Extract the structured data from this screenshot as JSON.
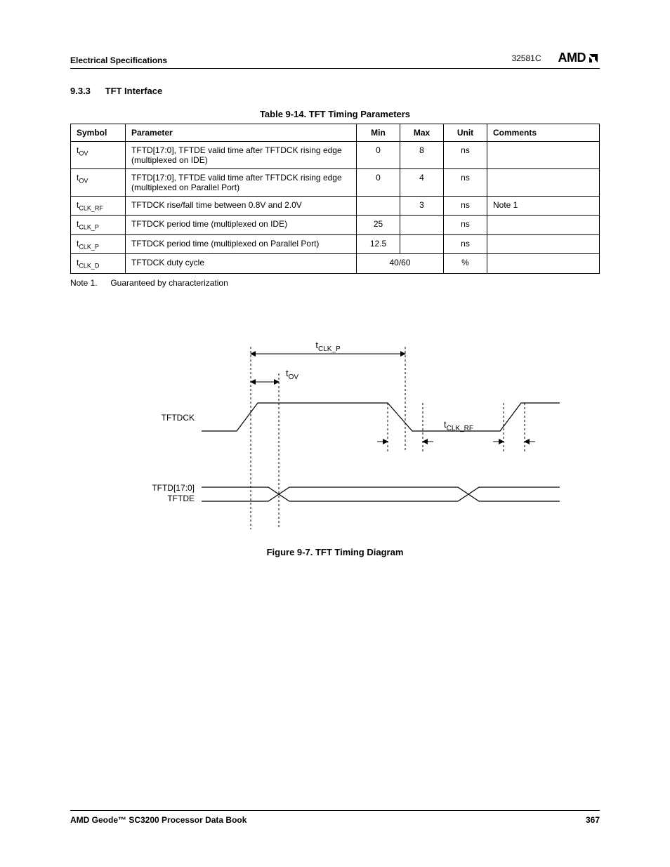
{
  "header": {
    "section": "Electrical Specifications",
    "docnum": "32581C",
    "brand": "AMD"
  },
  "heading": {
    "number": "9.3.3",
    "title": "TFT Interface"
  },
  "table": {
    "caption": "Table 9-14.  TFT Timing Parameters",
    "columns": {
      "symbol": "Symbol",
      "parameter": "Parameter",
      "min": "Min",
      "max": "Max",
      "unit": "Unit",
      "comments": "Comments"
    },
    "rows": [
      {
        "sym_base": "t",
        "sym_sub": "OV",
        "param": "TFTD[17:0], TFTDE valid time after TFTDCK rising edge (multiplexed on IDE)",
        "min": "0",
        "max": "8",
        "unit": "ns",
        "comments": ""
      },
      {
        "sym_base": "t",
        "sym_sub": "OV",
        "param": "TFTD[17:0], TFTDE valid time after TFTDCK rising edge (multiplexed on Parallel Port)",
        "min": "0",
        "max": "4",
        "unit": "ns",
        "comments": ""
      },
      {
        "sym_base": "t",
        "sym_sub": "CLK_RF",
        "param": "TFTDCK rise/fall time between 0.8V and 2.0V",
        "min": "",
        "max": "3",
        "unit": "ns",
        "comments": "Note 1"
      },
      {
        "sym_base": "t",
        "sym_sub": "CLK_P",
        "param": "TFTDCK period time (multiplexed on IDE)",
        "min": "25",
        "max": "",
        "unit": "ns",
        "comments": ""
      },
      {
        "sym_base": "t",
        "sym_sub": "CLK_P",
        "param": "TFTDCK period time (multiplexed on Parallel Port)",
        "min": "12.5",
        "max": "",
        "unit": "ns",
        "comments": ""
      },
      {
        "sym_base": "t",
        "sym_sub": "CLK_D",
        "param": "TFTDCK duty cycle",
        "min": "40/60",
        "max": "__SPAN__",
        "unit": "%",
        "comments": ""
      }
    ]
  },
  "note": {
    "label": "Note 1.",
    "text": "Guaranteed by characterization"
  },
  "figure": {
    "caption": "Figure 9-7.  TFT Timing Diagram",
    "labels": {
      "tclkp_base": "t",
      "tclkp_sub": "CLK_P",
      "tov_base": "t",
      "tov_sub": "OV",
      "tclkrf_base": "t",
      "tclkrf_sub": "CLK_RF",
      "sig1": "TFTDCK",
      "sig2a": "TFTD[17:0]",
      "sig2b": "TFTDE"
    }
  },
  "footer": {
    "title": "AMD Geode™ SC3200 Processor Data Book",
    "page": "367"
  }
}
